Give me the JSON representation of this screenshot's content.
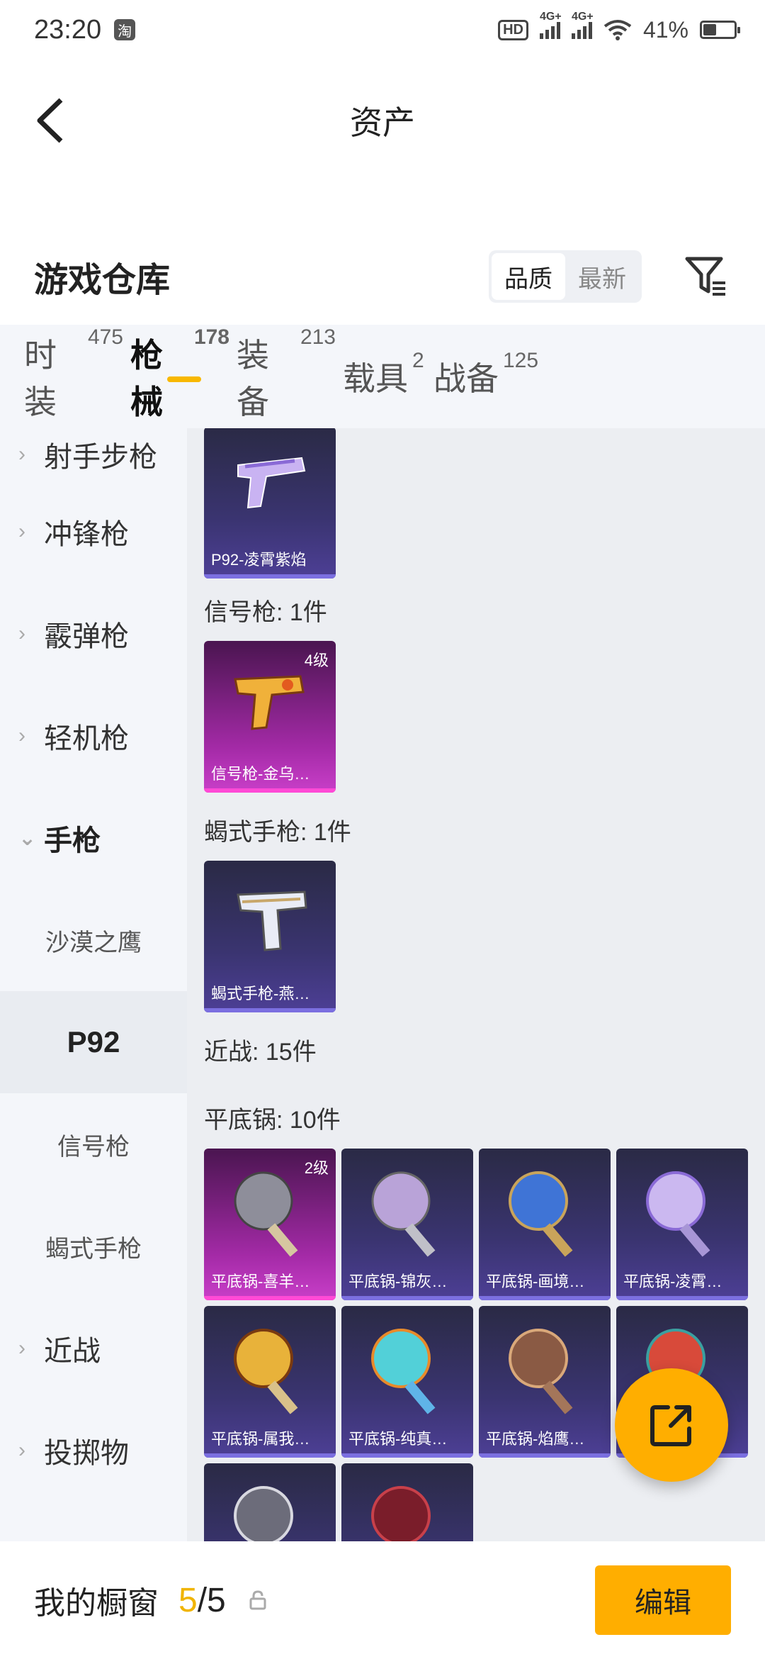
{
  "status_bar": {
    "time": "23:20",
    "app_badge": "淘",
    "hd": "HD",
    "net1": "4G+",
    "net2": "4G+",
    "battery": "41%"
  },
  "header": {
    "title": "资产"
  },
  "warehouse": {
    "title": "游戏仓库",
    "sort": [
      "品质",
      "最新"
    ]
  },
  "tabs": [
    {
      "label": "时装",
      "count": "475"
    },
    {
      "label": "枪械",
      "count": "178"
    },
    {
      "label": "装备",
      "count": "213"
    },
    {
      "label": "载具",
      "count": "2"
    },
    {
      "label": "战备",
      "count": "125"
    }
  ],
  "sidebar": [
    {
      "label": "射手步枪",
      "chevron": "›"
    },
    {
      "label": "冲锋枪",
      "chevron": "›"
    },
    {
      "label": "霰弹枪",
      "chevron": "›"
    },
    {
      "label": "轻机枪",
      "chevron": "›"
    },
    {
      "label": "手枪",
      "chevron": "⌄"
    },
    {
      "label": "沙漠之鹰"
    },
    {
      "label": "P92"
    },
    {
      "label": "信号枪"
    },
    {
      "label": "蝎式手枪"
    },
    {
      "label": "近战",
      "chevron": "›"
    },
    {
      "label": "投掷物",
      "chevron": "›"
    }
  ],
  "sections": {
    "flare": "信号枪: 1件",
    "scorpion": "蝎式手枪: 1件",
    "melee": "近战: 15件",
    "pan": "平底锅: 10件"
  },
  "cards": {
    "p92": {
      "name": "P92-凌霄紫焰"
    },
    "flare": {
      "name": "信号枪-金乌…",
      "level": "4级"
    },
    "scorpion": {
      "name": "蝎式手枪-燕…"
    },
    "pans": [
      {
        "name": "平底锅-喜羊…",
        "level": "2级"
      },
      {
        "name": "平底锅-锦灰…"
      },
      {
        "name": "平底锅-画境…"
      },
      {
        "name": "平底锅-凌霄…"
      },
      {
        "name": "平底锅-属我…"
      },
      {
        "name": "平底锅-纯真…"
      },
      {
        "name": "平底锅-焰鹰…"
      }
    ]
  },
  "bottom": {
    "label": "我的橱窗",
    "current": "5",
    "separator": "/5",
    "edit": "编辑"
  },
  "colors": {
    "accent": "#ffae00",
    "purple_card": "#3a3470",
    "pink_card": "#a32aa6"
  }
}
